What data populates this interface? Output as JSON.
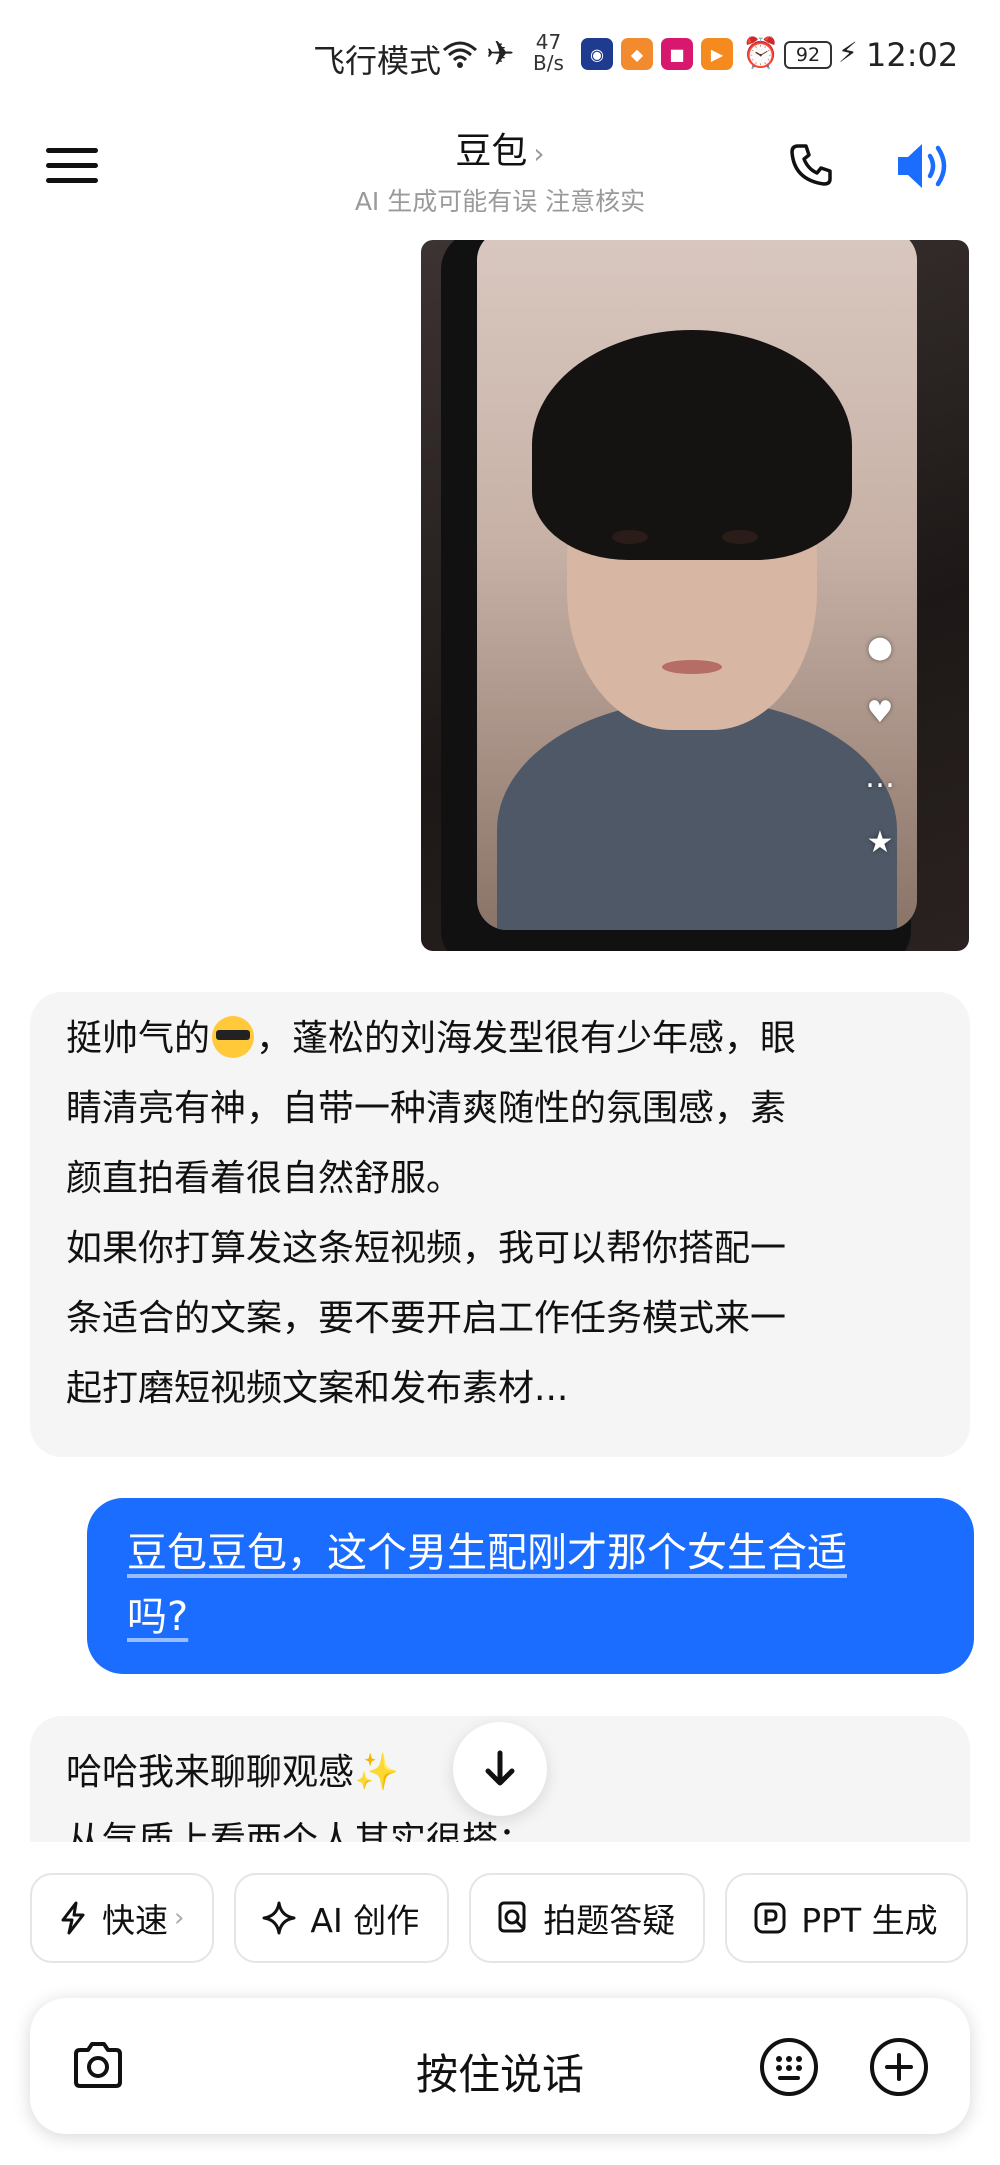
{
  "status_bar": {
    "mode": "飞行模式",
    "speed_value": "47",
    "speed_unit": "B/s",
    "battery": "92",
    "time": "12:02"
  },
  "header": {
    "title": "豆包",
    "subtitle": "AI 生成可能有误 注意核实"
  },
  "messages": {
    "ai_reply_1": {
      "line1_prefix": "挺帅气的",
      "line1_suffix": "，蓬松的刘海发型很有少年感，眼",
      "line2": "睛清亮有神，自带一种清爽随性的氛围感，素",
      "line3": "颜直拍看着很自然舒服。",
      "line4": "如果你打算发这条短视频，我可以帮你搭配一",
      "line5": "条适合的文案，要不要开启工作任务模式来一",
      "line6": "起打磨短视频文案和发布素材..."
    },
    "user_message": {
      "line1": "豆包豆包，这个男生配刚才那个女生合适",
      "line2": "吗?"
    },
    "ai_reply_2": {
      "line1_prefix": "哈哈我来聊聊观感",
      "line2": "从气质上看两个人其实很搭："
    }
  },
  "quick_actions": [
    {
      "label": "快速",
      "icon": "lightning-icon"
    },
    {
      "label": "AI 创作",
      "icon": "sparkle-icon"
    },
    {
      "label": "拍题答疑",
      "icon": "photo-question-icon"
    },
    {
      "label": "PPT 生成",
      "icon": "ppt-icon"
    }
  ],
  "input": {
    "hold_to_talk": "按住说话"
  },
  "colors": {
    "accent_blue": "#1a6dff",
    "ai_bubble_bg": "#f5f5f5"
  }
}
